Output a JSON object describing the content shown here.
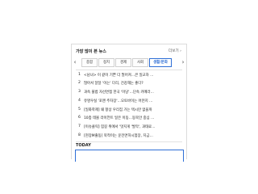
{
  "panel": {
    "title": "가장 많이 본 뉴스",
    "more_label": "더보기 ›"
  },
  "tabs": {
    "prev_icon": "chevron-left-icon",
    "next_icon": "chevron-right-icon",
    "items": [
      {
        "label": "종합",
        "active": false
      },
      {
        "label": "정치",
        "active": false
      },
      {
        "label": "경제",
        "active": false
      },
      {
        "label": "사회",
        "active": false
      },
      {
        "label": "생활/문화",
        "active": true
      }
    ]
  },
  "news": [
    {
      "rank": "1",
      "title": "<남녀> 이 같이 기쁜 더 멀어져…큰 일교차 ..."
    },
    {
      "rank": "2",
      "title": "많아서 달달 '이는' 다리, 건강해는 좋다?"
    },
    {
      "rank": "3",
      "title": "과속 불법 자선면접 한국 '이당'…단속 카메라…"
    },
    {
      "rank": "4",
      "title": "유명우실 '포맨 주차장'…오토바이는 어떤지 ..."
    },
    {
      "rank": "5",
      "title": "[일화학제] 왜 항상 우리집 가는 택시만 없을까"
    },
    {
      "rank": "6",
      "title": "10층 테몰 라이언트 일은 이동…동북안 중심 …"
    },
    {
      "rank": "7",
      "title": "[이슈클릭] 힘길 위에서 '멋지게 '발막', 과태료…"
    },
    {
      "rank": "8",
      "title": "[현장M출동] 북적이는 운전면허시험장, 지금…"
    }
  ],
  "today": {
    "label": "TODAY"
  },
  "colors": {
    "accent": "#2f6fd6",
    "text": "#222222",
    "border": "#dcdcdc"
  }
}
